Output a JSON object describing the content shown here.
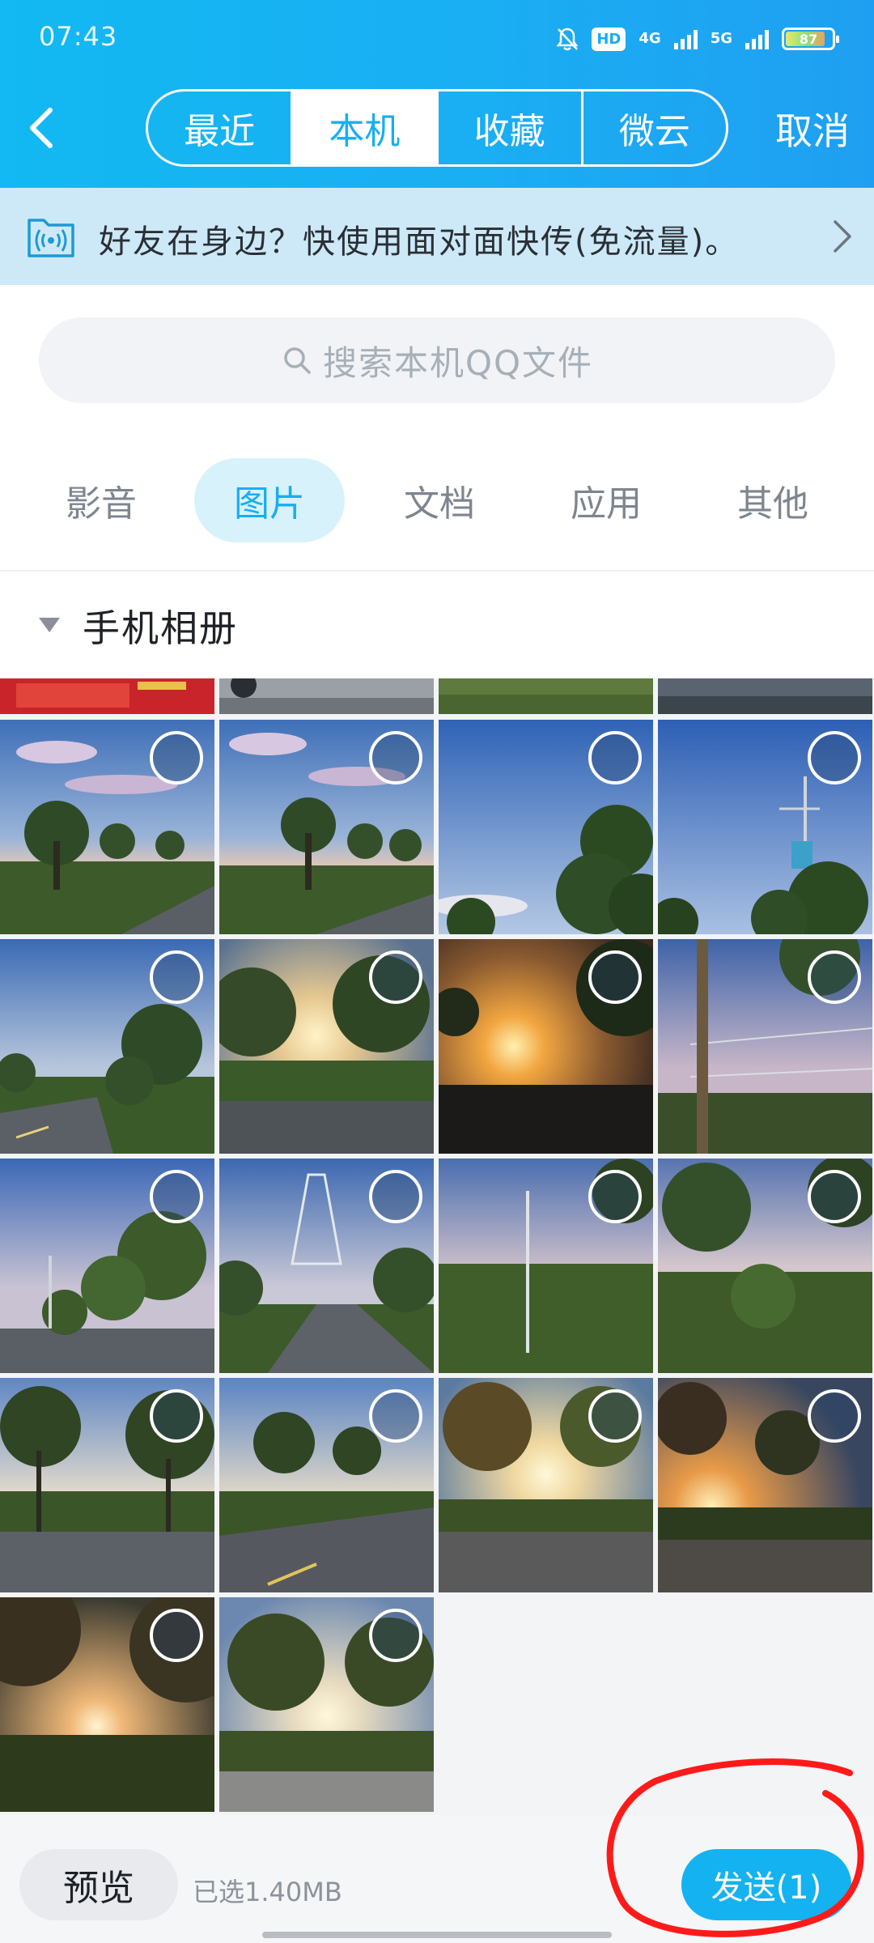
{
  "status_bar": {
    "time": "07:43",
    "hd_label": "HD",
    "net_4g": "4G",
    "net_5g": "5G",
    "battery": "87"
  },
  "nav": {
    "tabs": [
      {
        "label": "最近"
      },
      {
        "label": "本机"
      },
      {
        "label": "收藏"
      },
      {
        "label": "微云"
      }
    ],
    "active_tab": "本机",
    "cancel_label": "取消"
  },
  "banner": {
    "text": "好友在身边？快使用面对面快传(免流量)。"
  },
  "search": {
    "placeholder": "搜索本机QQ文件"
  },
  "categories": {
    "items": [
      {
        "label": "影音"
      },
      {
        "label": "图片"
      },
      {
        "label": "文档"
      },
      {
        "label": "应用"
      },
      {
        "label": "其他"
      }
    ],
    "active": "图片"
  },
  "album": {
    "title": "手机相册"
  },
  "bottom_bar": {
    "preview_label": "预览",
    "selected_info": "已选1.40MB",
    "send_label": "发送(1)"
  },
  "colors": {
    "accent": "#18aef2",
    "header_start": "#12b9f2",
    "banner_bg": "#cde9f8",
    "annotation_red": "#ff1a1a"
  }
}
